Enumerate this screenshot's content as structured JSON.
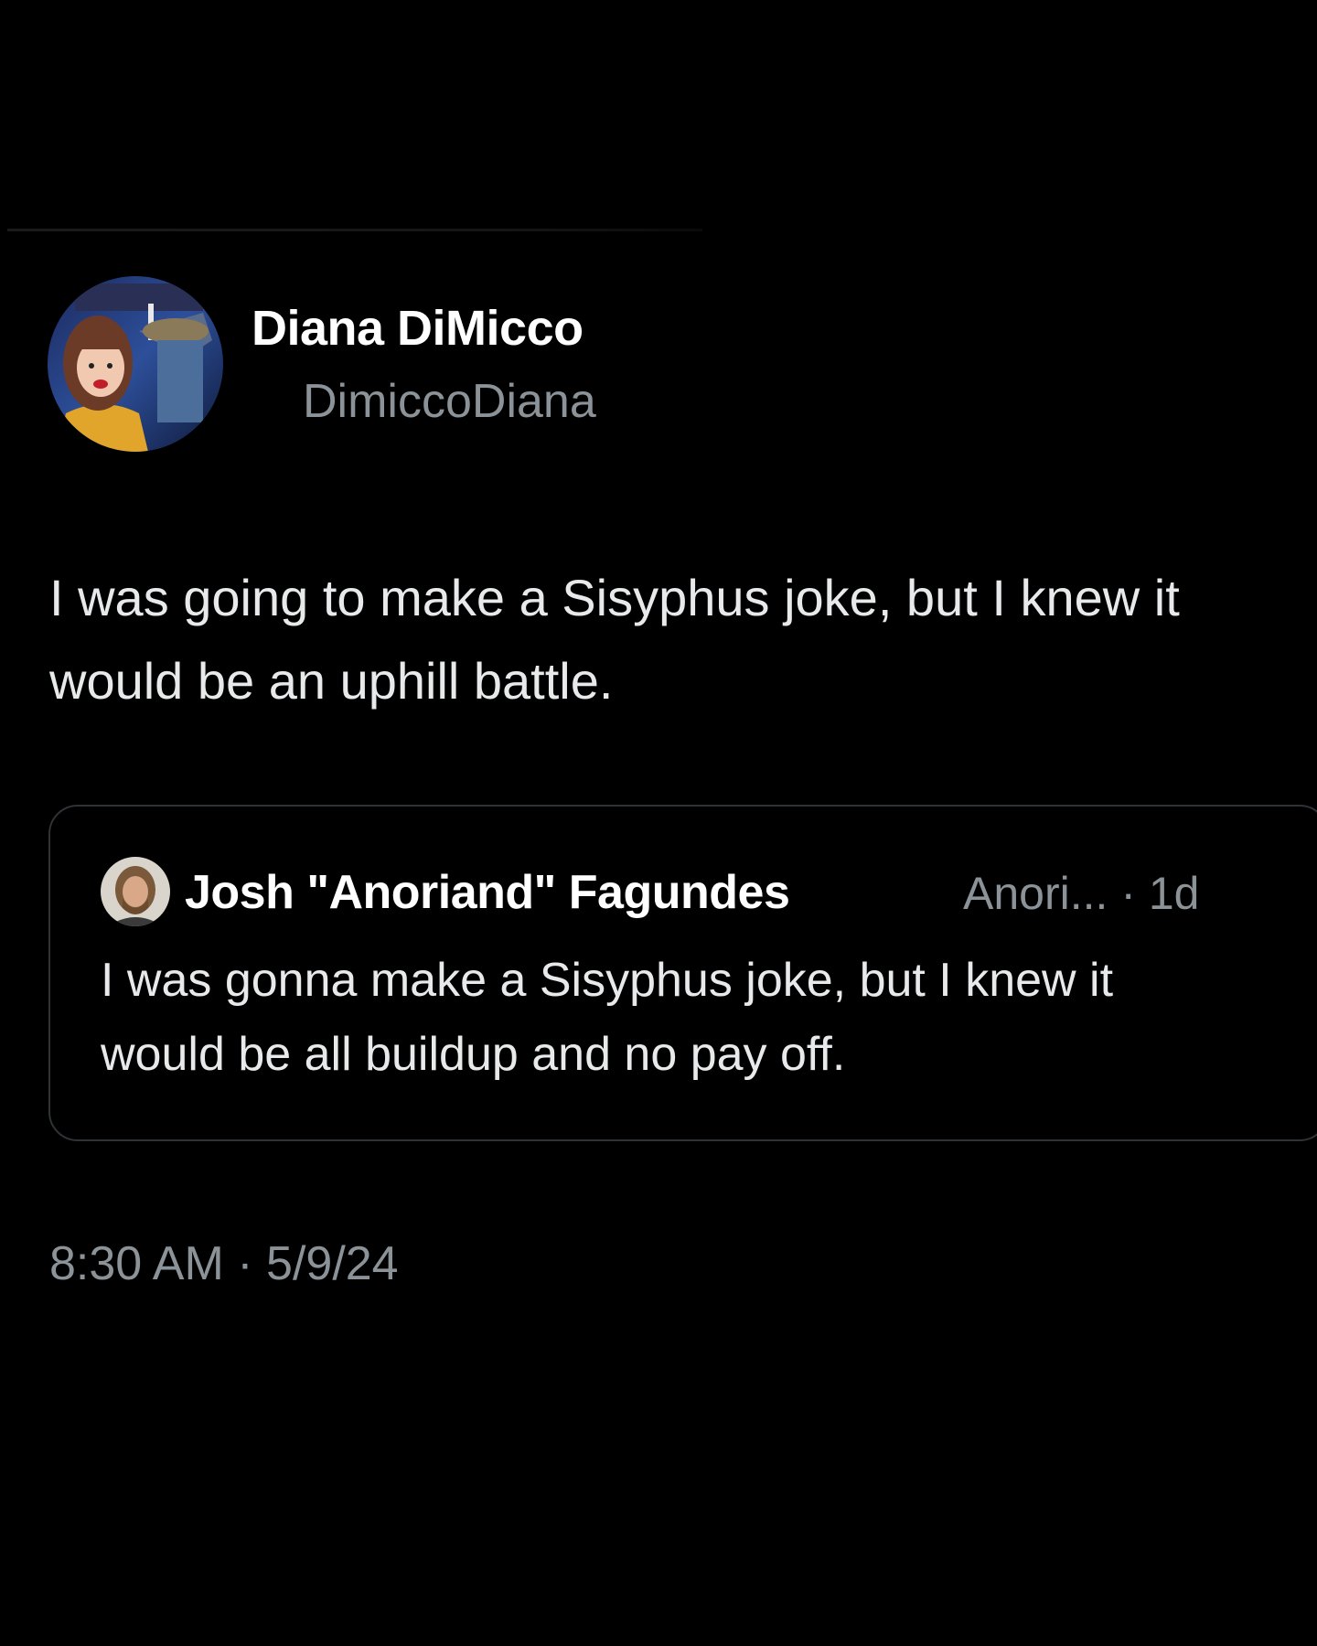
{
  "tweet": {
    "author": {
      "display_name": "Diana DiMicco",
      "handle": "DimiccoDiana",
      "avatar_icon": "user-avatar-icon"
    },
    "text": "I was going to make a Sisyphus joke, but I knew it would be an uphill battle.",
    "quoted_tweet": {
      "author": {
        "display_name": "Josh \"Anoriand\" Fagundes",
        "handle_truncated": "Anori...",
        "age": "1d",
        "avatar_icon": "user-avatar-icon"
      },
      "meta_separator": "·",
      "text": "I was gonna make a Sisyphus joke, but I knew it would be all buildup and no pay off."
    },
    "timestamp": {
      "time": "8:30 AM",
      "separator": "·",
      "date": "5/9/24"
    }
  },
  "colors": {
    "background": "#000000",
    "primary_text": "#e7e9ea",
    "secondary_text": "#8b9298",
    "border": "#2f3336"
  }
}
